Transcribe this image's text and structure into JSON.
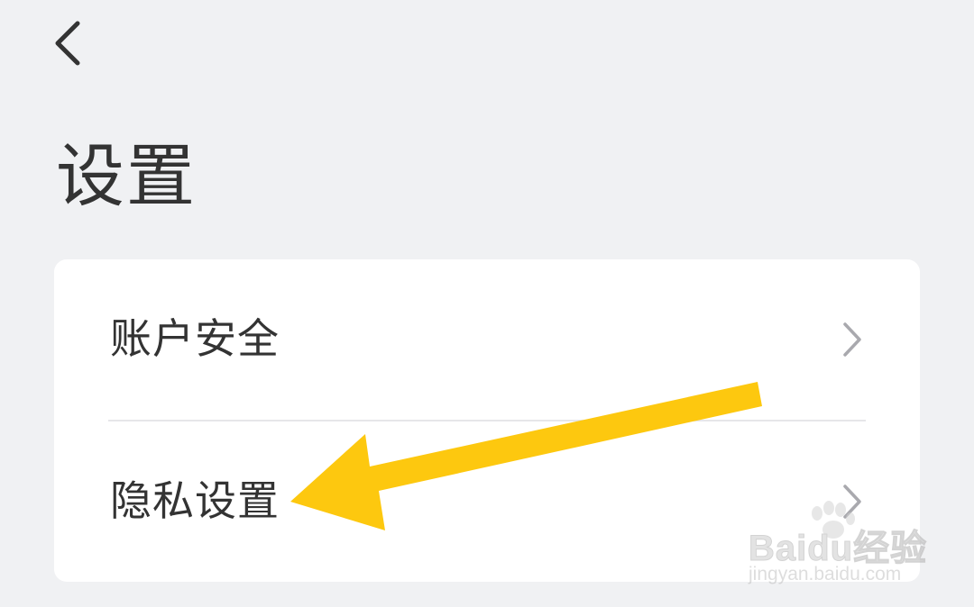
{
  "header": {
    "back_icon": "chevron-left-icon"
  },
  "page": {
    "title": "设置"
  },
  "settings_list": {
    "items": [
      {
        "label": "账户安全",
        "icon": "chevron-right-icon"
      },
      {
        "label": "隐私设置",
        "icon": "chevron-right-icon"
      }
    ]
  },
  "annotation": {
    "arrow_color": "#fdc80f",
    "points_to": "隐私设置"
  },
  "watermark": {
    "logo_text": "Baidu经验",
    "url": "jingyan.baidu.com"
  },
  "colors": {
    "background": "#f0f1f3",
    "card": "#ffffff",
    "text": "#333333",
    "chevron": "#a9a9ae",
    "divider": "#e6e6e9"
  }
}
